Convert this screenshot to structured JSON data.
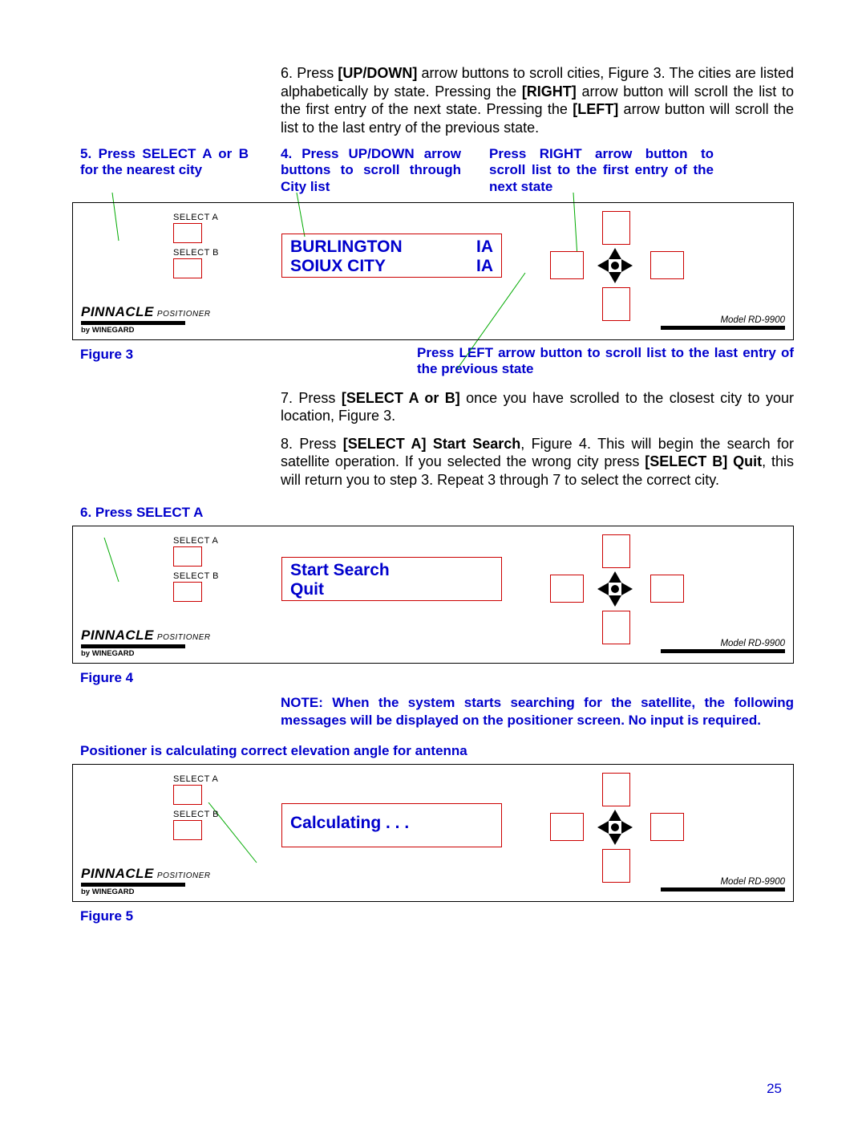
{
  "instructions": {
    "step6": {
      "num": "6.",
      "t1": "Press ",
      "b1": "[UP/DOWN]",
      "t2": " arrow buttons to scroll cities, Figure 3.  The cities are listed alphabetically by state.  Pressing the ",
      "b2": "[RIGHT]",
      "t3": " arrow button will scroll the list to the first entry of the next state.  Pressing the ",
      "b3": "[LEFT]",
      "t4": " arrow button will scroll the list to the last entry of the previous state."
    },
    "step7": {
      "num": "7.",
      "t1": "Press ",
      "b1": "[SELECT A or B]",
      "t2": " once you have scrolled to the closest city to your location, Figure 3."
    },
    "step8": {
      "num": "8.",
      "t1": "Press ",
      "b1": "[SELECT A] Start Search",
      "t2": ", Figure 4.  This will begin the search for satellite operation.  If you selected the wrong city press ",
      "b2": "[SELECT B] Quit",
      "t3": ", this will return you to step 3.  Repeat 3 through 7 to select the correct city."
    }
  },
  "callouts": {
    "c5": "5. Press SELECT A or B for the nearest city",
    "c4": "4.  Press UP/DOWN arrow buttons to scroll through City list",
    "cRight": "Press RIGHT arrow button to scroll list to the first entry of the next state",
    "cLeft": "Press LEFT arrow button to scroll list to the last entry of the previous state",
    "c6": "6. Press SELECT A",
    "calc": "Positioner is calculating correct elevation angle for antenna"
  },
  "lcd": {
    "fig3": {
      "row1_city": "BURLINGTON",
      "row1_st": "IA",
      "row2_city": "SOIUX CITY",
      "row2_st": "IA"
    },
    "fig4": {
      "row1": "Start Search",
      "row2": "Quit"
    },
    "fig5": {
      "row1": "Calculating . . ."
    }
  },
  "labels": {
    "selectA": "SELECT A",
    "selectB": "SELECT B",
    "pinnacle": "PINNACLE",
    "positioner": "POSITIONER",
    "byWinegard": "by WINEGARD",
    "model": "Model RD-9900",
    "fig3": "Figure 3",
    "fig4": "Figure 4",
    "fig5": "Figure 5"
  },
  "note": "NOTE:  When the system starts searching for the satellite, the following messages will be displayed on the positioner screen.  No input is required.",
  "pageNum": "25"
}
